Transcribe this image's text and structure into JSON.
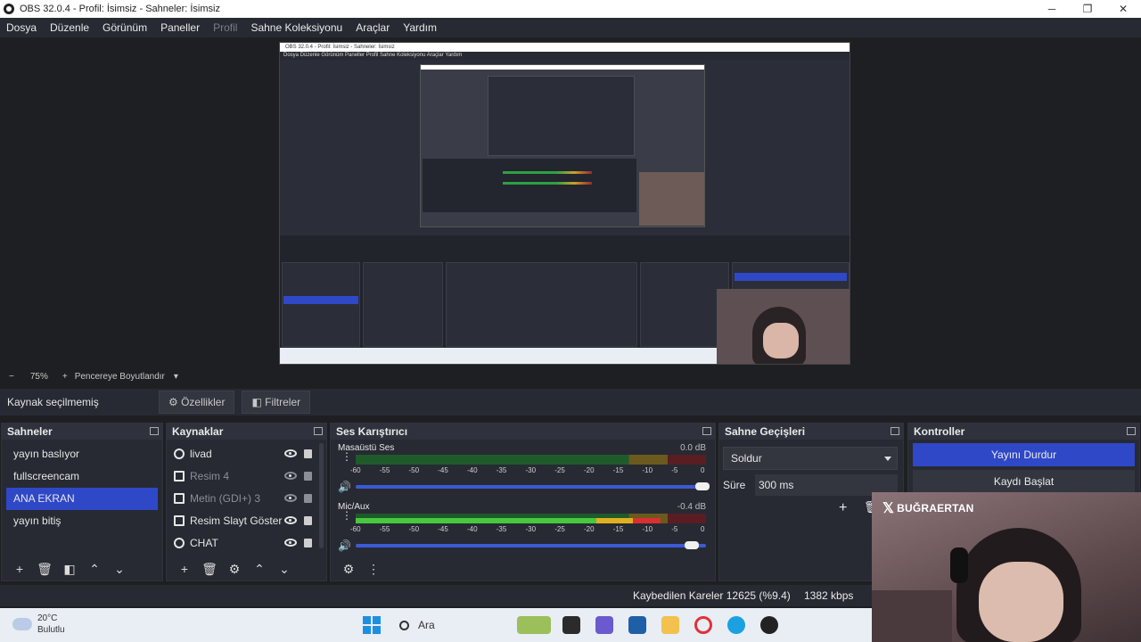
{
  "window": {
    "title": "OBS 32.0.4 - Profil: İsimsiz - Sahneler: İsimsiz",
    "minimize": "─",
    "maximize": "❐",
    "close": "✕"
  },
  "menu": [
    "Dosya",
    "Düzenle",
    "Görünüm",
    "Paneller",
    "Profil",
    "Sahne Koleksiyonu",
    "Araçlar",
    "Yardım"
  ],
  "preview": {
    "inner_title": "OBS 32.0.4 - Profil: İsimsiz - Sahneler: İsimsiz",
    "inner_menu": "Dosya  Düzenle  Görünüm  Paneller  Profil  Sahne Koleksiyonu  Araçlar  Yardım"
  },
  "zoom": {
    "minus": "−",
    "level": "75%",
    "plus": "+",
    "mode": "Pencereye Boyutlandır",
    "caret": "▾"
  },
  "source_toolbar": {
    "no_source": "Kaynak seçilmemiş",
    "properties": "Özellikler",
    "filters": "Filtreler"
  },
  "scenes": {
    "title": "Sahneler",
    "items": [
      "yayın baslıyor",
      "fullscreencam",
      "ANA EKRAN",
      "yayın bitiş"
    ],
    "selected_index": 2
  },
  "sources": {
    "title": "Kaynaklar",
    "items": [
      {
        "name": "livad",
        "visible": true
      },
      {
        "name": "Resim 4",
        "visible": false
      },
      {
        "name": "Metin (GDI+) 3",
        "visible": false
      },
      {
        "name": "Resim Slayt Göster",
        "visible": true
      },
      {
        "name": "CHAT",
        "visible": true
      }
    ]
  },
  "mixer": {
    "title": "Ses Karıştırıcı",
    "channels": [
      {
        "name": "Masaüstü Ses",
        "db": "0.0 dB",
        "level": 0.0
      },
      {
        "name": "Mic/Aux",
        "db": "-0.4 dB",
        "level": 0.87
      }
    ],
    "scale": [
      "-60",
      "-55",
      "-50",
      "-45",
      "-40",
      "-35",
      "-30",
      "-25",
      "-20",
      "-15",
      "-10",
      "-5",
      "0"
    ]
  },
  "transitions": {
    "title": "Sahne Geçişleri",
    "selected": "Soldur",
    "duration_label": "Süre",
    "duration_value": "300 ms"
  },
  "controls": {
    "title": "Kontroller",
    "stop_stream": "Yayını Durdur",
    "start_record": "Kaydı Başlat"
  },
  "status": {
    "dropped": "Kaybedilen Kareler 12625 (%9.4)",
    "kbps": "1382 kbps"
  },
  "webcam": {
    "handle": "BUĞRAERTAN"
  },
  "taskbar": {
    "temp": "20°C",
    "weather": "Bulutlu",
    "search": "Ara"
  },
  "colors": {
    "accent": "#2f48c7",
    "meter_green": "#48c840",
    "meter_yellow": "#e0b020",
    "meter_red": "#d83030"
  }
}
